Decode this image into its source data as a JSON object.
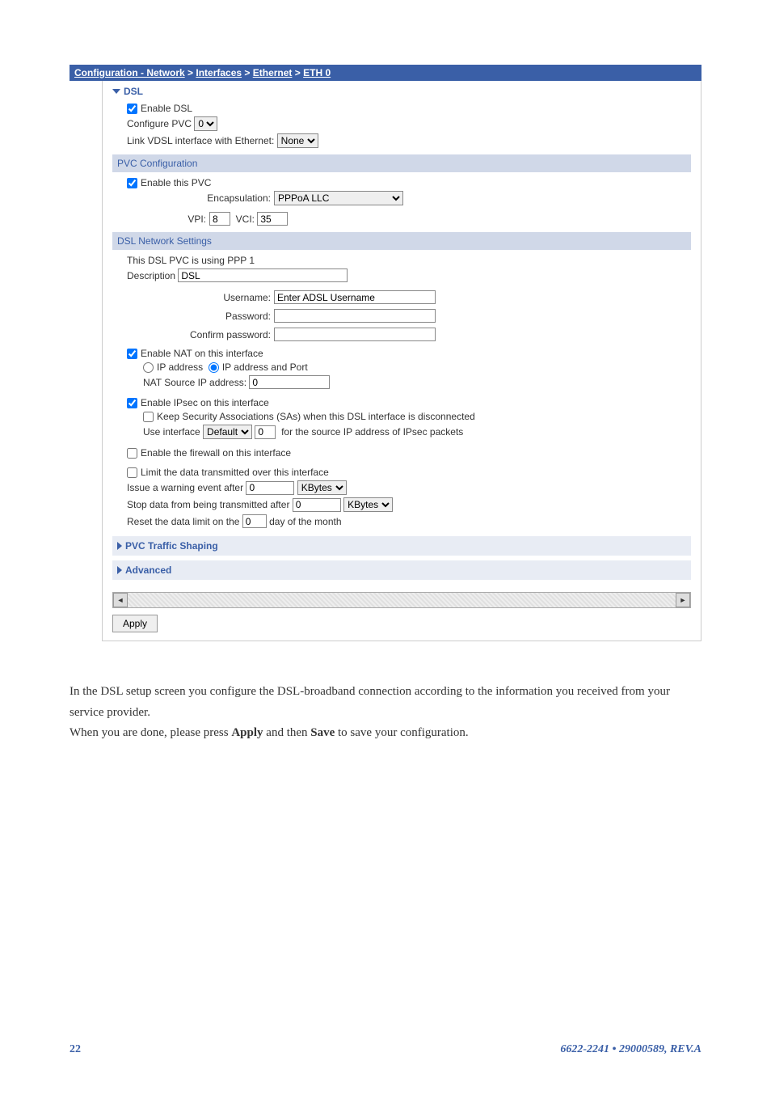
{
  "breadcrumb": {
    "parts": [
      "Configuration - Network",
      "Interfaces",
      "Ethernet",
      "ETH 0"
    ],
    "sep": " > "
  },
  "dsl": {
    "header": "DSL",
    "enable_dsl": "Enable DSL",
    "configure_pvc_label": "Configure PVC",
    "configure_pvc_value": "0",
    "link_vdsl_label": "Link VDSL interface with Ethernet:",
    "link_vdsl_value": "None"
  },
  "pvc_config": {
    "header": "PVC Configuration",
    "enable_this_pvc": "Enable this PVC",
    "encapsulation_label": "Encapsulation:",
    "encapsulation_value": "PPPoA LLC",
    "vpi_label": "VPI:",
    "vpi_value": "8",
    "vci_label": "VCI:",
    "vci_value": "35"
  },
  "dsl_net": {
    "header": "DSL Network Settings",
    "ppp_info": "This DSL PVC is using PPP 1",
    "description_label": "Description",
    "description_value": "DSL",
    "username_label": "Username:",
    "username_placeholder": "Enter ADSL Username",
    "password_label": "Password:",
    "confirm_label": "Confirm password:",
    "enable_nat": "Enable NAT on this interface",
    "nat_ip": "IP address",
    "nat_ip_port": "IP address and Port",
    "nat_src_label": "NAT Source IP address:",
    "nat_src_value": "0",
    "enable_ipsec": "Enable IPsec on this interface",
    "keep_sa": "Keep Security Associations (SAs) when this DSL interface is disconnected",
    "use_iface_label": "Use interface",
    "use_iface_value": "Default",
    "use_iface_num": "0",
    "src_ip_ipsec": "for the source IP address of IPsec packets",
    "enable_firewall": "Enable the firewall on this interface",
    "limit_data": "Limit the data transmitted over this interface",
    "warn_label": "Issue a warning event after",
    "warn_value": "0",
    "warn_unit": "KBytes",
    "stop_label": "Stop data from being transmitted after",
    "stop_value": "0",
    "stop_unit": "KBytes",
    "reset_label_pre": "Reset the data limit on the",
    "reset_value": "0",
    "reset_label_post": "day of the month"
  },
  "sections": {
    "pvc_traffic": "PVC Traffic Shaping",
    "advanced": "Advanced"
  },
  "buttons": {
    "apply": "Apply"
  },
  "body_text": {
    "line1": "In the DSL setup screen you configure the DSL-broadband connection according to the information you received from your service provider.",
    "line2_pre": "When you are done, please press ",
    "apply_bold": "Apply",
    "line2_mid": " and then ",
    "save_bold": "Save",
    "line2_post": " to save your configuration."
  },
  "footer": {
    "page": "22",
    "doc": "6622-2241 • 29000589, REV.A"
  }
}
